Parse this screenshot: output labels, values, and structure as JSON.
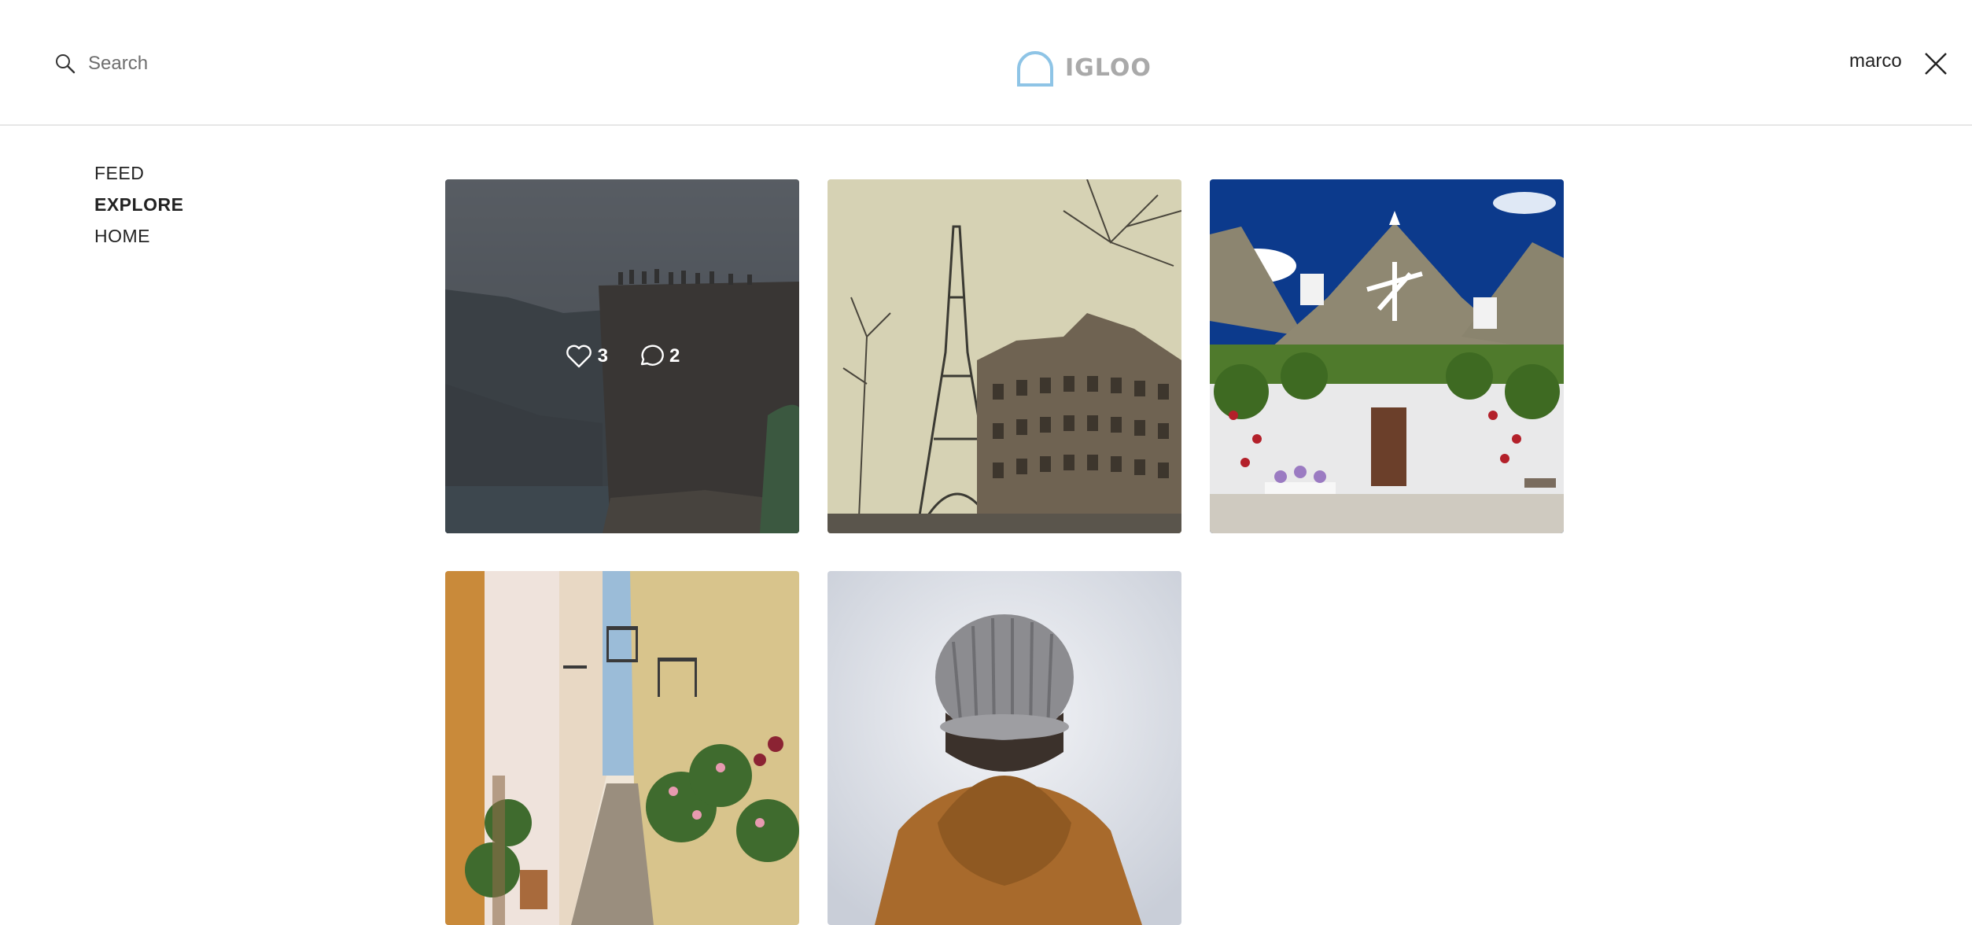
{
  "header": {
    "search": {
      "placeholder": "Search",
      "value": ""
    },
    "logo": {
      "text": "IGLOO"
    },
    "user": {
      "name": "marco"
    }
  },
  "nav": {
    "items": [
      {
        "label": "FEED",
        "active": false
      },
      {
        "label": "EXPLORE",
        "active": true
      },
      {
        "label": "HOME",
        "active": false
      }
    ]
  },
  "posts": [
    {
      "subject": "cliff overlooking fjord with people on top",
      "likes": "3",
      "comments": "2",
      "hovered": true
    },
    {
      "subject": "eiffel tower and parisian building"
    },
    {
      "subject": "trulli houses with cone roofs"
    },
    {
      "subject": "narrow alley with flowers and balconies"
    },
    {
      "subject": "person in knit beanie and brown coat"
    }
  ],
  "colors": {
    "accent": "#8ec4e6",
    "logo_text": "#a9a9a9"
  }
}
